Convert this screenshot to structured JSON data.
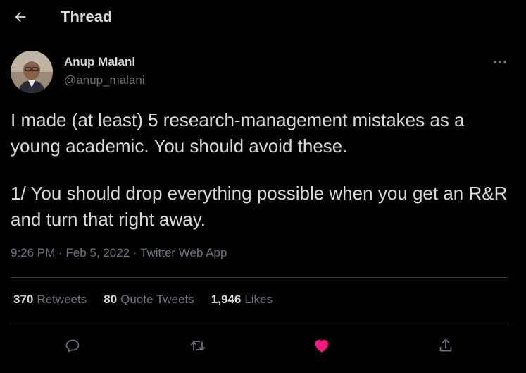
{
  "header": {
    "title": "Thread"
  },
  "author": {
    "name": "Anup Malani",
    "handle": "@anup_malani"
  },
  "tweet": {
    "paragraph_1": "I made (at least) 5 research-management mistakes as a young academic. You should avoid these.",
    "paragraph_2": "1/ You should drop everything possible when you get an R&R and turn that right away.",
    "time": "9:26 PM",
    "date": "Feb 5, 2022",
    "source": "Twitter Web App",
    "separator": "·"
  },
  "stats": {
    "retweets": {
      "count": "370",
      "label": "Retweets"
    },
    "quote_tweets": {
      "count": "80",
      "label": "Quote Tweets"
    },
    "likes": {
      "count": "1,946",
      "label": "Likes"
    }
  },
  "icons": {
    "back": "arrow-left-icon",
    "more": "more-horizontal-icon",
    "reply": "reply-icon",
    "retweet": "retweet-icon",
    "like": "heart-filled-icon",
    "share": "share-icon"
  },
  "colors": {
    "background": "#000000",
    "text": "#d9d9d9",
    "secondary": "#6e767d",
    "divider": "#2f3336",
    "like": "#f91880"
  }
}
